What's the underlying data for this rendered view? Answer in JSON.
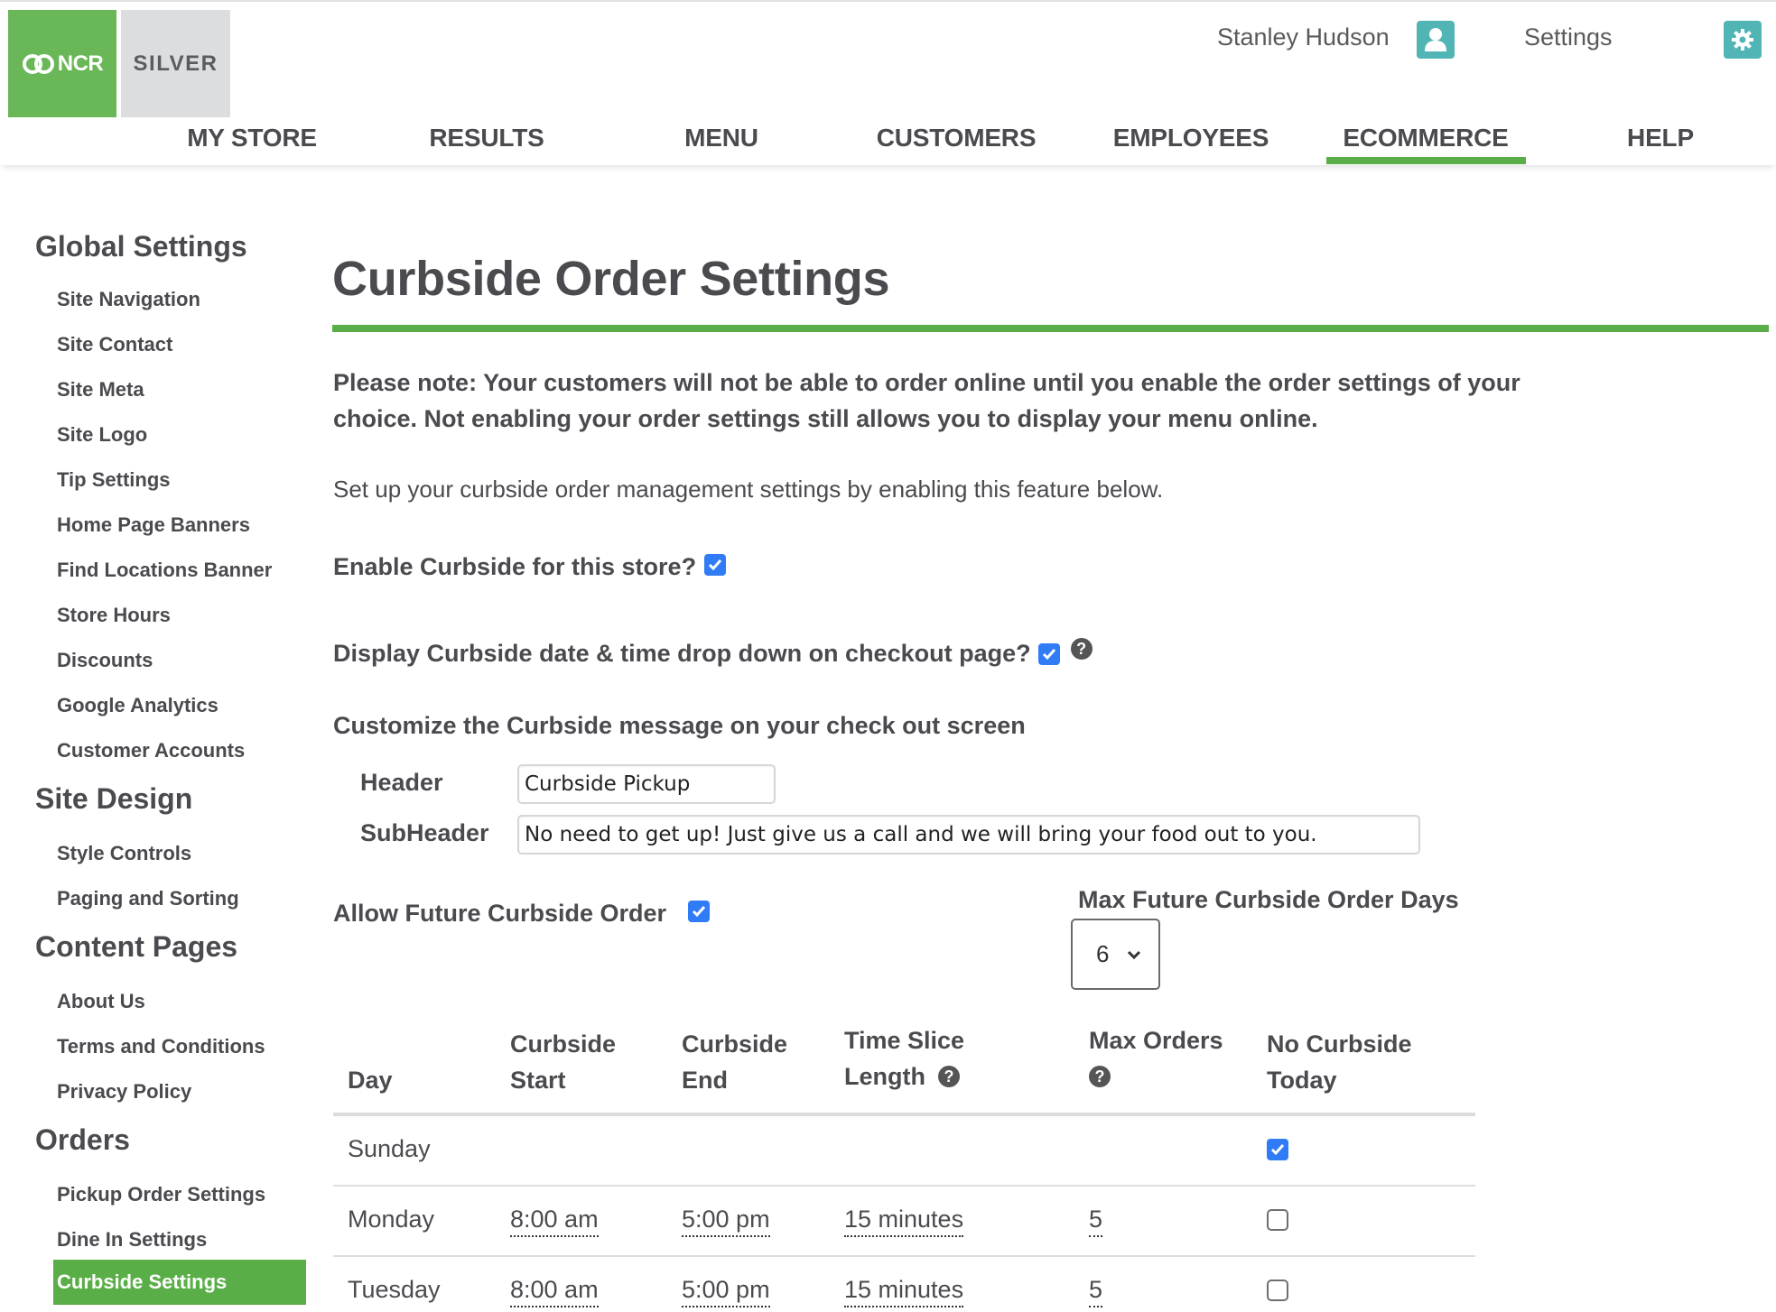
{
  "header": {
    "brand_ncr": "NCR",
    "brand_silver": "SILVER",
    "user_name": "Stanley Hudson",
    "settings_label": "Settings",
    "accent_color": "#5aae48",
    "icon_color": "#52b5b5"
  },
  "nav": {
    "items": [
      {
        "label": "MY STORE",
        "active": false
      },
      {
        "label": "RESULTS",
        "active": false
      },
      {
        "label": "MENU",
        "active": false
      },
      {
        "label": "CUSTOMERS",
        "active": false
      },
      {
        "label": "EMPLOYEES",
        "active": false
      },
      {
        "label": "ECOMMERCE",
        "active": true
      },
      {
        "label": "HELP",
        "active": false
      }
    ]
  },
  "sidebar": {
    "sections": [
      {
        "title": "Global Settings",
        "items": [
          "Site Navigation",
          "Site Contact",
          "Site Meta",
          "Site Logo",
          "Tip Settings",
          "Home Page Banners",
          "Find Locations Banner",
          "Store Hours",
          "Discounts",
          "Google Analytics",
          "Customer Accounts"
        ]
      },
      {
        "title": "Site Design",
        "items": [
          "Style Controls",
          "Paging and Sorting"
        ]
      },
      {
        "title": "Content Pages",
        "items": [
          "About Us",
          "Terms and Conditions",
          "Privacy Policy"
        ]
      },
      {
        "title": "Orders",
        "items": [
          "Pickup Order Settings",
          "Dine In Settings",
          "Curbside Settings"
        ]
      }
    ],
    "active_item": "Curbside Settings"
  },
  "main": {
    "title": "Curbside Order Settings",
    "note": "Please note: Your customers will not be able to order online until you enable the order settings of your choice. Not enabling your order settings still allows you to display your menu online.",
    "intro": "Set up your curbside order management settings by enabling this feature below.",
    "enable_label": "Enable Curbside for this store?",
    "enable_checked": true,
    "display_dropdown_label": "Display Curbside date & time drop down on checkout page?",
    "display_dropdown_checked": true,
    "customize_label": "Customize the Curbside message on your check out screen",
    "header_field_label": "Header",
    "header_field_value": "Curbside Pickup",
    "subheader_field_label": "SubHeader",
    "subheader_field_value": "No need to get up! Just give us a call and we will bring your food out to you.",
    "allow_future_label": "Allow Future Curbside Order",
    "allow_future_checked": true,
    "max_days_label": "Max Future Curbside Order Days",
    "max_days_value": "6"
  },
  "table": {
    "headers": {
      "day": "Day",
      "start_l1": "Curbside",
      "start_l2": "Start",
      "end_l1": "Curbside",
      "end_l2": "End",
      "slice_l1": "Time Slice",
      "slice_l2": "Length",
      "max_l1": "Max Orders",
      "none_l1": "No Curbside",
      "none_l2": "Today"
    },
    "rows": [
      {
        "day": "Sunday",
        "start": "",
        "end": "",
        "slice": "",
        "max": "",
        "no_curbside": true
      },
      {
        "day": "Monday",
        "start": "8:00 am",
        "end": "5:00 pm",
        "slice": "15 minutes",
        "max": "5",
        "no_curbside": false
      },
      {
        "day": "Tuesday",
        "start": "8:00 am",
        "end": "5:00 pm",
        "slice": "15 minutes",
        "max": "5",
        "no_curbside": false
      }
    ]
  }
}
